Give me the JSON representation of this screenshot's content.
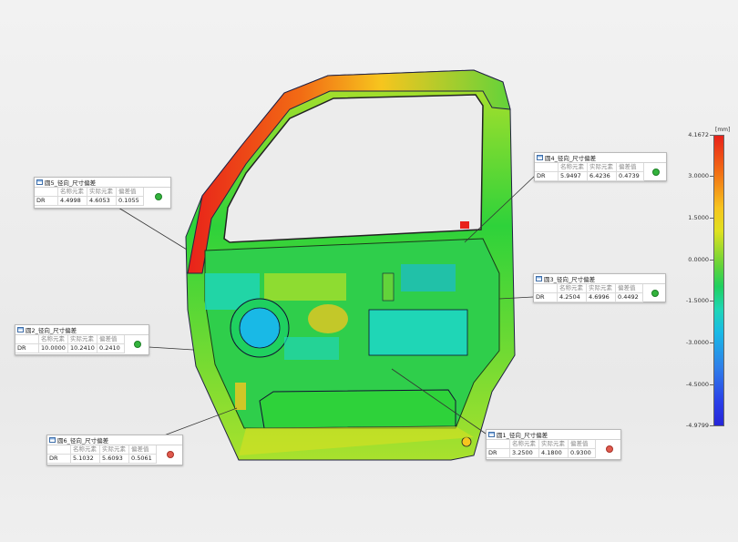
{
  "scale": {
    "unit": "[mm]",
    "ticks": [
      "4.1672",
      "3.0000",
      "1.5000",
      "0.0000",
      "-1.5000",
      "-3.0000",
      "-4.5000",
      "-4.9799"
    ],
    "colors": [
      "#e8221a",
      "#f26b14",
      "#f6c51e",
      "#62d33a",
      "#1fd05f",
      "#1fd6b6",
      "#19b9e6",
      "#2f7fe9",
      "#2626d8"
    ]
  },
  "headers": {
    "nominal": "名称元素",
    "actual": "实际元素",
    "deviation": "偏差值"
  },
  "callouts": [
    {
      "title": "圆5_径向_尺寸偏差",
      "type": "DR",
      "nominal": "4.4998",
      "actual": "4.6053",
      "deviation": "0.1055",
      "status": "ok"
    },
    {
      "title": "圆4_径向_尺寸偏差",
      "type": "DR",
      "nominal": "5.9497",
      "actual": "6.4236",
      "deviation": "0.4739",
      "status": "ok"
    },
    {
      "title": "圆3_径向_尺寸偏差",
      "type": "DR",
      "nominal": "4.2504",
      "actual": "4.6996",
      "deviation": "0.4492",
      "status": "ok"
    },
    {
      "title": "圆2_径向_尺寸偏差",
      "type": "DR",
      "nominal": "10.0000",
      "actual": "10.2410",
      "deviation": "0.2410",
      "status": "ok"
    },
    {
      "title": "圆6_径向_尺寸偏差",
      "type": "DR",
      "nominal": "5.1032",
      "actual": "5.6093",
      "deviation": "0.5061",
      "status": "ng"
    },
    {
      "title": "圆1_径向_尺寸偏差",
      "type": "DR",
      "nominal": "3.2500",
      "actual": "4.1800",
      "deviation": "0.9300",
      "status": "ng"
    }
  ]
}
